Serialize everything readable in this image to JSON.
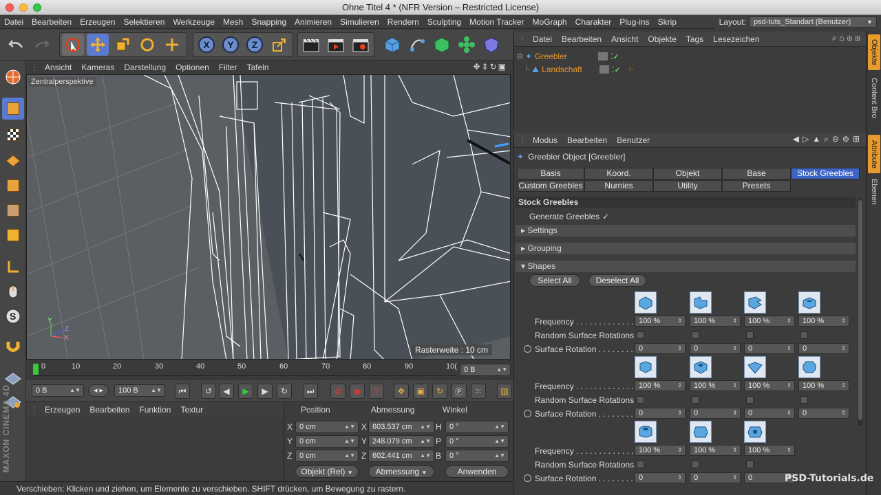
{
  "window": {
    "title": "Ohne Titel 4 * (NFR Version – Restricted License)"
  },
  "menubar": {
    "items": [
      "Datei",
      "Bearbeiten",
      "Erzeugen",
      "Selektieren",
      "Werkzeuge",
      "Mesh",
      "Snapping",
      "Animieren",
      "Simulieren",
      "Rendern",
      "Sculpting",
      "Motion Tracker",
      "MoGraph",
      "Charakter",
      "Plug-ins",
      "Skrip"
    ],
    "layout_label": "Layout:",
    "layout_value": "psd-tuts_Standart (Benutzer)"
  },
  "toolbar": {
    "axis_x": "X",
    "axis_y": "Y",
    "axis_z": "Z"
  },
  "viewport": {
    "menu": [
      "Ansicht",
      "Kameras",
      "Darstellung",
      "Optionen",
      "Filter",
      "Tafeln"
    ],
    "label": "Zentralperspektive",
    "grid_info": "Rasterweite : 10 cm",
    "axes": {
      "y": "Y",
      "z": "Z",
      "x": "X"
    }
  },
  "timeline": {
    "ticks": [
      "0",
      "10",
      "20",
      "30",
      "40",
      "50",
      "60",
      "70",
      "80",
      "90",
      "10("
    ],
    "frame_field": "0 B"
  },
  "anim": {
    "start_field": "0 B",
    "end_field": "100 B"
  },
  "material_manager": {
    "menu": [
      "Erzeugen",
      "Bearbeiten",
      "Funktion",
      "Textur"
    ]
  },
  "coords": {
    "headers": {
      "position": "Position",
      "size": "Abmessung",
      "angle": "Winkel"
    },
    "rows": [
      {
        "pos_label": "X",
        "pos_value": "0 cm",
        "size_label": "X",
        "size_value": "603.537 cm",
        "ang_label": "H",
        "ang_value": "0 °"
      },
      {
        "pos_label": "Y",
        "pos_value": "0 cm",
        "size_label": "Y",
        "size_value": "248.079 cm",
        "ang_label": "P",
        "ang_value": "0 °"
      },
      {
        "pos_label": "Z",
        "pos_value": "0 cm",
        "size_label": "Z",
        "size_value": "602.441 cm",
        "ang_label": "B",
        "ang_value": "0 °"
      }
    ],
    "mode_button": "Objekt (Rel)",
    "size_button": "Abmessung",
    "apply_button": "Anwenden"
  },
  "status": {
    "text": "Verschieben: Klicken und ziehen, um Elemente zu verschieben. SHIFT drücken, um Bewegung zu rastern."
  },
  "objects_panel": {
    "menu": [
      "Datei",
      "Bearbeiten",
      "Ansicht",
      "Objekte",
      "Tags",
      "Lesezeichen"
    ],
    "tree": [
      {
        "name": "Greebler",
        "color": "#e79b2d"
      },
      {
        "name": "Landschaft",
        "color": "#e79b2d"
      }
    ]
  },
  "attributes_panel": {
    "menu": [
      "Modus",
      "Bearbeiten",
      "Benutzer"
    ],
    "object_title": "Greebler Object [Greebler]",
    "tabs_row1": [
      "Basis",
      "Koord.",
      "Objekt",
      "Base",
      "Stock Greebles"
    ],
    "tabs_row2": [
      "Custom Greebles",
      "Nurnies",
      "Utility",
      "Presets"
    ],
    "active_tab": "Stock Greebles",
    "section_title": "Stock Greebles",
    "generate_label": "Generate Greebles",
    "groups": [
      "Settings",
      "Grouping",
      "Shapes"
    ],
    "select_all": "Select All",
    "deselect_all": "Deselect All",
    "param_labels": {
      "frequency": "Frequency . . . . . . . . . . . . . .",
      "random_rot": "Random Surface Rotations",
      "surface_rot": "Surface Rotation . . . . . . . . ."
    },
    "rows": [
      {
        "frequency": [
          "100 %",
          "100 %",
          "100 %",
          "100 %"
        ],
        "rotation": [
          "0",
          "0",
          "0",
          "0"
        ]
      },
      {
        "frequency": [
          "100 %",
          "100 %",
          "100 %",
          "100 %"
        ],
        "rotation": [
          "0",
          "0",
          "0",
          "0"
        ]
      },
      {
        "frequency": [
          "100 %",
          "100 %",
          "100 %"
        ],
        "rotation": [
          "0",
          "0",
          "0"
        ]
      }
    ]
  },
  "right_tabs": [
    "Objekte",
    "Content Bro",
    "Attribute",
    "Ebenen"
  ],
  "watermark": "PSD-Tutorials.de",
  "brand": "MAXON CINEMA 4D",
  "colors": {
    "accent": "#3d64c4",
    "orange": "#e79b2d"
  }
}
